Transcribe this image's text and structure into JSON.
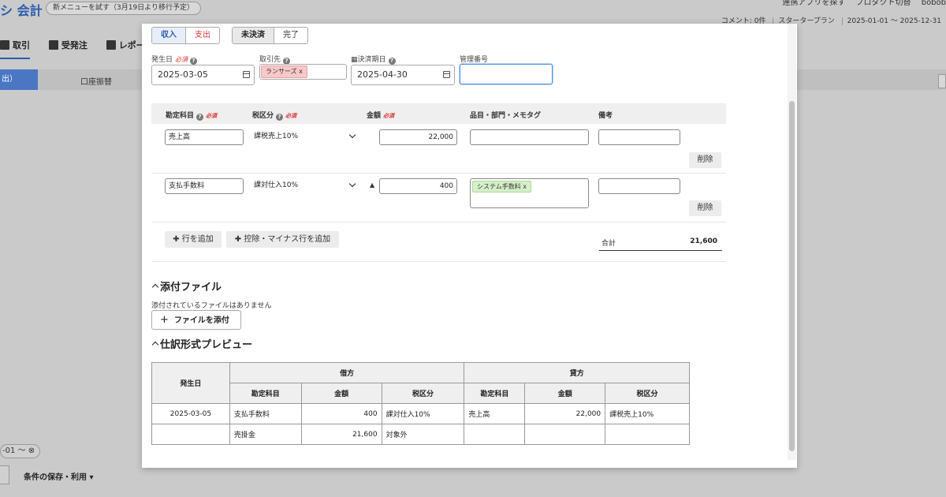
{
  "background": {
    "logo": "シ 会計",
    "try_new_menu": "新メニューを試す（3月19日より移行予定）",
    "top_links": [
      "連携アプリを探す",
      "プロダクト切替",
      "bobob"
    ],
    "comment": "コメント: 0件",
    "plan": "スタータープラン",
    "period": "2025-01-01 〜 2025-12-31",
    "nav": [
      "取引",
      "受発注",
      "レポー"
    ],
    "tab_active": "出）",
    "tab_transfer": "口座振替",
    "filter_chip": "-01 〜",
    "save_conditions": "条件の保存・利用"
  },
  "form": {
    "type_income": "収入",
    "type_expense": "支出",
    "status_unsettled": "未決済",
    "status_done": "完了",
    "issue_date_label": "発生日",
    "required": "必須",
    "issue_date": "2025-03-05",
    "partner_label": "取引先",
    "partner_tag": "ランサーズ x",
    "due_date_label": "決済期日",
    "due_date": "2025-04-30",
    "mgmt_no_label": "管理番号",
    "mgmt_no": ""
  },
  "lines": {
    "headers": {
      "account": "勘定科目",
      "tax": "税区分",
      "amount": "金額",
      "tags": "品目・部門・メモタグ",
      "note": "備考"
    },
    "rows": [
      {
        "account": "売上高",
        "tax": "課税売上10%",
        "amount": "22,000",
        "tag": "",
        "delete": "削除",
        "minus": ""
      },
      {
        "account": "支払手数料",
        "tax": "課対仕入10%",
        "amount": "400",
        "tag": "システム手数料 x",
        "delete": "削除",
        "minus": "▲"
      }
    ],
    "add_row": "行を追加",
    "add_minus_row": "控除・マイナス行を追加",
    "total_label": "合計",
    "total_value": "21,600"
  },
  "attachments": {
    "title": "添付ファイル",
    "empty": "添付されているファイルはありません",
    "add_button": "ファイルを添付"
  },
  "preview": {
    "title": "仕訳形式プレビュー",
    "col_date": "発生日",
    "debit": "借方",
    "credit": "貸方",
    "col_account": "勘定科目",
    "col_amount": "金額",
    "col_tax": "税区分",
    "rows": [
      {
        "date": "2025-03-05",
        "d_account": "支払手数料",
        "d_amount": "400",
        "d_tax": "課対仕入10%",
        "c_account": "売上高",
        "c_amount": "22,000",
        "c_tax": "課税売上10%"
      },
      {
        "date": "",
        "d_account": "売掛金",
        "d_amount": "21,600",
        "d_tax": "対象外",
        "c_account": "",
        "c_amount": "",
        "c_tax": ""
      }
    ]
  }
}
